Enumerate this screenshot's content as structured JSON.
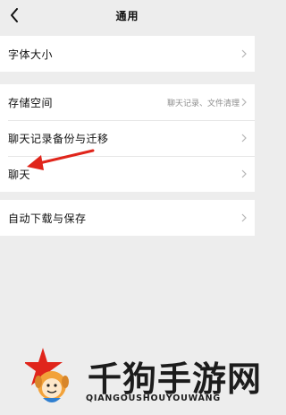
{
  "header": {
    "title": "通用"
  },
  "groups": [
    {
      "items": [
        {
          "label": "字体大小"
        }
      ]
    },
    {
      "items": [
        {
          "label": "存储空间",
          "detail": "聊天记录、文件清理"
        },
        {
          "label": "聊天记录备份与迁移"
        },
        {
          "label": "聊天"
        }
      ]
    },
    {
      "items": [
        {
          "label": "自动下载与保存"
        }
      ]
    }
  ],
  "icons": {
    "back": "chevron-left-icon",
    "row": "chevron-right-icon",
    "annotation": "red-arrow"
  },
  "colors": {
    "background": "#ededed",
    "card": "#ffffff",
    "annotation_arrow": "#e0251b"
  },
  "watermark": {
    "text_cn": "千狗手游网",
    "text_en": "QIANGOUSHOUYOUWANG"
  }
}
